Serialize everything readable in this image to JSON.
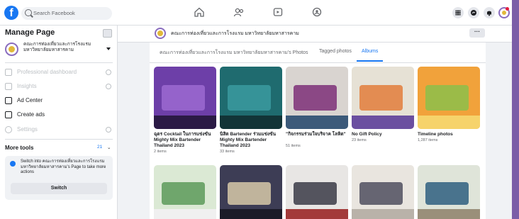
{
  "topbar": {
    "logo": "f",
    "search_placeholder": "Search Facebook",
    "nav_icons": [
      "home-icon",
      "people-icon",
      "video-icon",
      "groups-icon"
    ],
    "right_icons": [
      "menu-grid-icon",
      "messenger-icon",
      "bell-icon",
      "account-icon"
    ]
  },
  "sidebar": {
    "title": "Manage Page",
    "page_name": "คณะการท่องเที่ยวและการโรงแรม มหาวิทยาลัยมหาสารคาม",
    "items": [
      {
        "label": "Professional dashboard",
        "icon": "dashboard-icon",
        "disabled": true
      },
      {
        "label": "Insights",
        "icon": "insights-icon",
        "disabled": true
      },
      {
        "label": "Ad Center",
        "icon": "megaphone-icon",
        "disabled": false
      },
      {
        "label": "Create ads",
        "icon": "edit-icon",
        "disabled": false
      },
      {
        "label": "Settings",
        "icon": "settings-icon",
        "disabled": true
      }
    ],
    "more_tools": "More tools",
    "more_tools_count": "21",
    "switch_text": "Switch into คณะการท่องเที่ยวและการโรงแรม มหาวิทยาลัยมหาสารคาม's Page to take more actions",
    "switch_button": "Switch"
  },
  "main": {
    "page_name": "คณะการท่องเที่ยวและการโรงแรม มหาวิทยาลัยมหาสารคาม",
    "tabs": [
      {
        "label": "คณะการท่องเที่ยวและการโรงแรม มหาวิทยาลัยมหาสารคาม's Photos",
        "active": false
      },
      {
        "label": "Tagged photos",
        "active": false
      },
      {
        "label": "Albums",
        "active": true
      }
    ],
    "albums": [
      {
        "title": "ฉุดร Cocktail ในการแข่งขัน Mighty Mix Bartender Thailand 2023",
        "count": "2 items",
        "colors": [
          "#6d3fa8",
          "#9c6ad1",
          "#2b1a45"
        ]
      },
      {
        "title": "นิสิต Bartender ร่วมแข่งขัน Mighty Mix Bartender Thailand 2023",
        "count": "33 items",
        "colors": [
          "#1f6b6f",
          "#3b9aa0",
          "#123437"
        ]
      },
      {
        "title": "\"กิจกรรมร่วมใจบริจาค โลหิต\"",
        "count": "51 items",
        "colors": [
          "#d9d4d0",
          "#7d2f78",
          "#3c5a7a"
        ]
      },
      {
        "title": "No Gift Policy",
        "count": "23 items",
        "colors": [
          "#e6e1d5",
          "#e27d3b",
          "#6b4fa0"
        ]
      },
      {
        "title": "Timeline photos",
        "count": "1,287 items",
        "colors": [
          "#f1a23b",
          "#8cc04b",
          "#f6d36b"
        ]
      },
      {
        "title": "",
        "count": "",
        "colors": [
          "#dbe9d4",
          "#5c9a59",
          "#f0f0f0"
        ]
      },
      {
        "title": "",
        "count": "",
        "colors": [
          "#3d3d55",
          "#d7c9a9",
          "#1b1b28"
        ]
      },
      {
        "title": "",
        "count": "",
        "colors": [
          "#e8e6e4",
          "#3a3a46",
          "#a33a3a"
        ]
      },
      {
        "title": "",
        "count": "",
        "colors": [
          "#e9e5df",
          "#4f4f5f",
          "#b9b2a9"
        ]
      },
      {
        "title": "",
        "count": "",
        "colors": [
          "#dfe4d9",
          "#2f5f7f",
          "#9a8f7a"
        ]
      }
    ]
  }
}
